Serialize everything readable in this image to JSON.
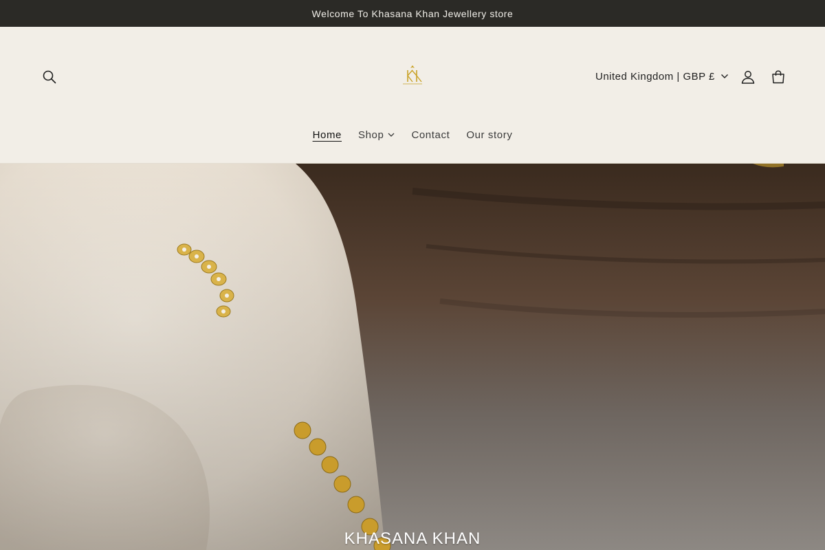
{
  "announcement": {
    "text": "Welcome To Khasana Khan Jewellery store"
  },
  "header": {
    "logo_text": "KK",
    "locale_label": "United Kingdom | GBP £",
    "icons": {
      "search": "search-icon",
      "account": "account-icon",
      "cart": "cart-icon",
      "chevron": "chevron-down-icon"
    }
  },
  "nav": {
    "items": [
      {
        "label": "Home",
        "active": true
      },
      {
        "label": "Shop",
        "has_dropdown": true
      },
      {
        "label": "Contact"
      },
      {
        "label": "Our story"
      }
    ]
  },
  "hero": {
    "title": "KHASANA KHAN"
  },
  "colors": {
    "announcement_bg": "#2b2a26",
    "header_bg": "#f2eee7",
    "gold": "#c9a227"
  }
}
